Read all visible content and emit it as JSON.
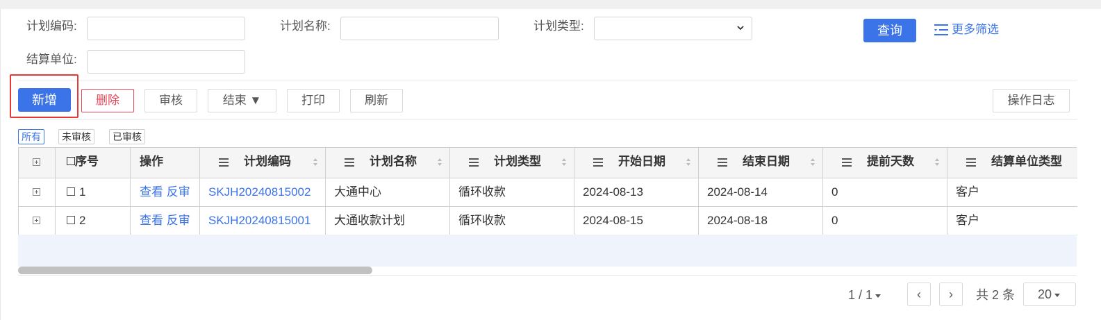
{
  "filters": {
    "plan_code_label": "计划编码:",
    "plan_name_label": "计划名称:",
    "plan_type_label": "计划类型:",
    "settle_unit_label": "结算单位:",
    "query_button": "查询",
    "more_filter": "更多筛选"
  },
  "toolbar": {
    "add": "新增",
    "delete": "删除",
    "audit": "审核",
    "finish": "结束 ▼",
    "print": "打印",
    "refresh": "刷新",
    "log": "操作日志"
  },
  "tabs": [
    "所有",
    "未审核",
    "已审核"
  ],
  "table": {
    "headers": {
      "seq": "序号",
      "op": "操作",
      "code": "计划编码",
      "name": "计划名称",
      "type": "计划类型",
      "start": "开始日期",
      "end": "结束日期",
      "advance": "提前天数",
      "unit_type": "结算单位类型"
    },
    "rows": [
      {
        "seq": "1",
        "view": "查看",
        "unaudit": "反审",
        "code": "SKJH20240815002",
        "name": "大通中心",
        "type": "循环收款",
        "start": "2024-08-13",
        "end": "2024-08-14",
        "advance": "0",
        "unit_type": "客户"
      },
      {
        "seq": "2",
        "view": "查看",
        "unaudit": "反审",
        "code": "SKJH20240815001",
        "name": "大通收款计划",
        "type": "循环收款",
        "start": "2024-08-15",
        "end": "2024-08-18",
        "advance": "0",
        "unit_type": "客户"
      }
    ]
  },
  "pager": {
    "page": "1 / 1",
    "prev": "‹",
    "next": "›",
    "total": "共 2 条",
    "size": "20"
  }
}
